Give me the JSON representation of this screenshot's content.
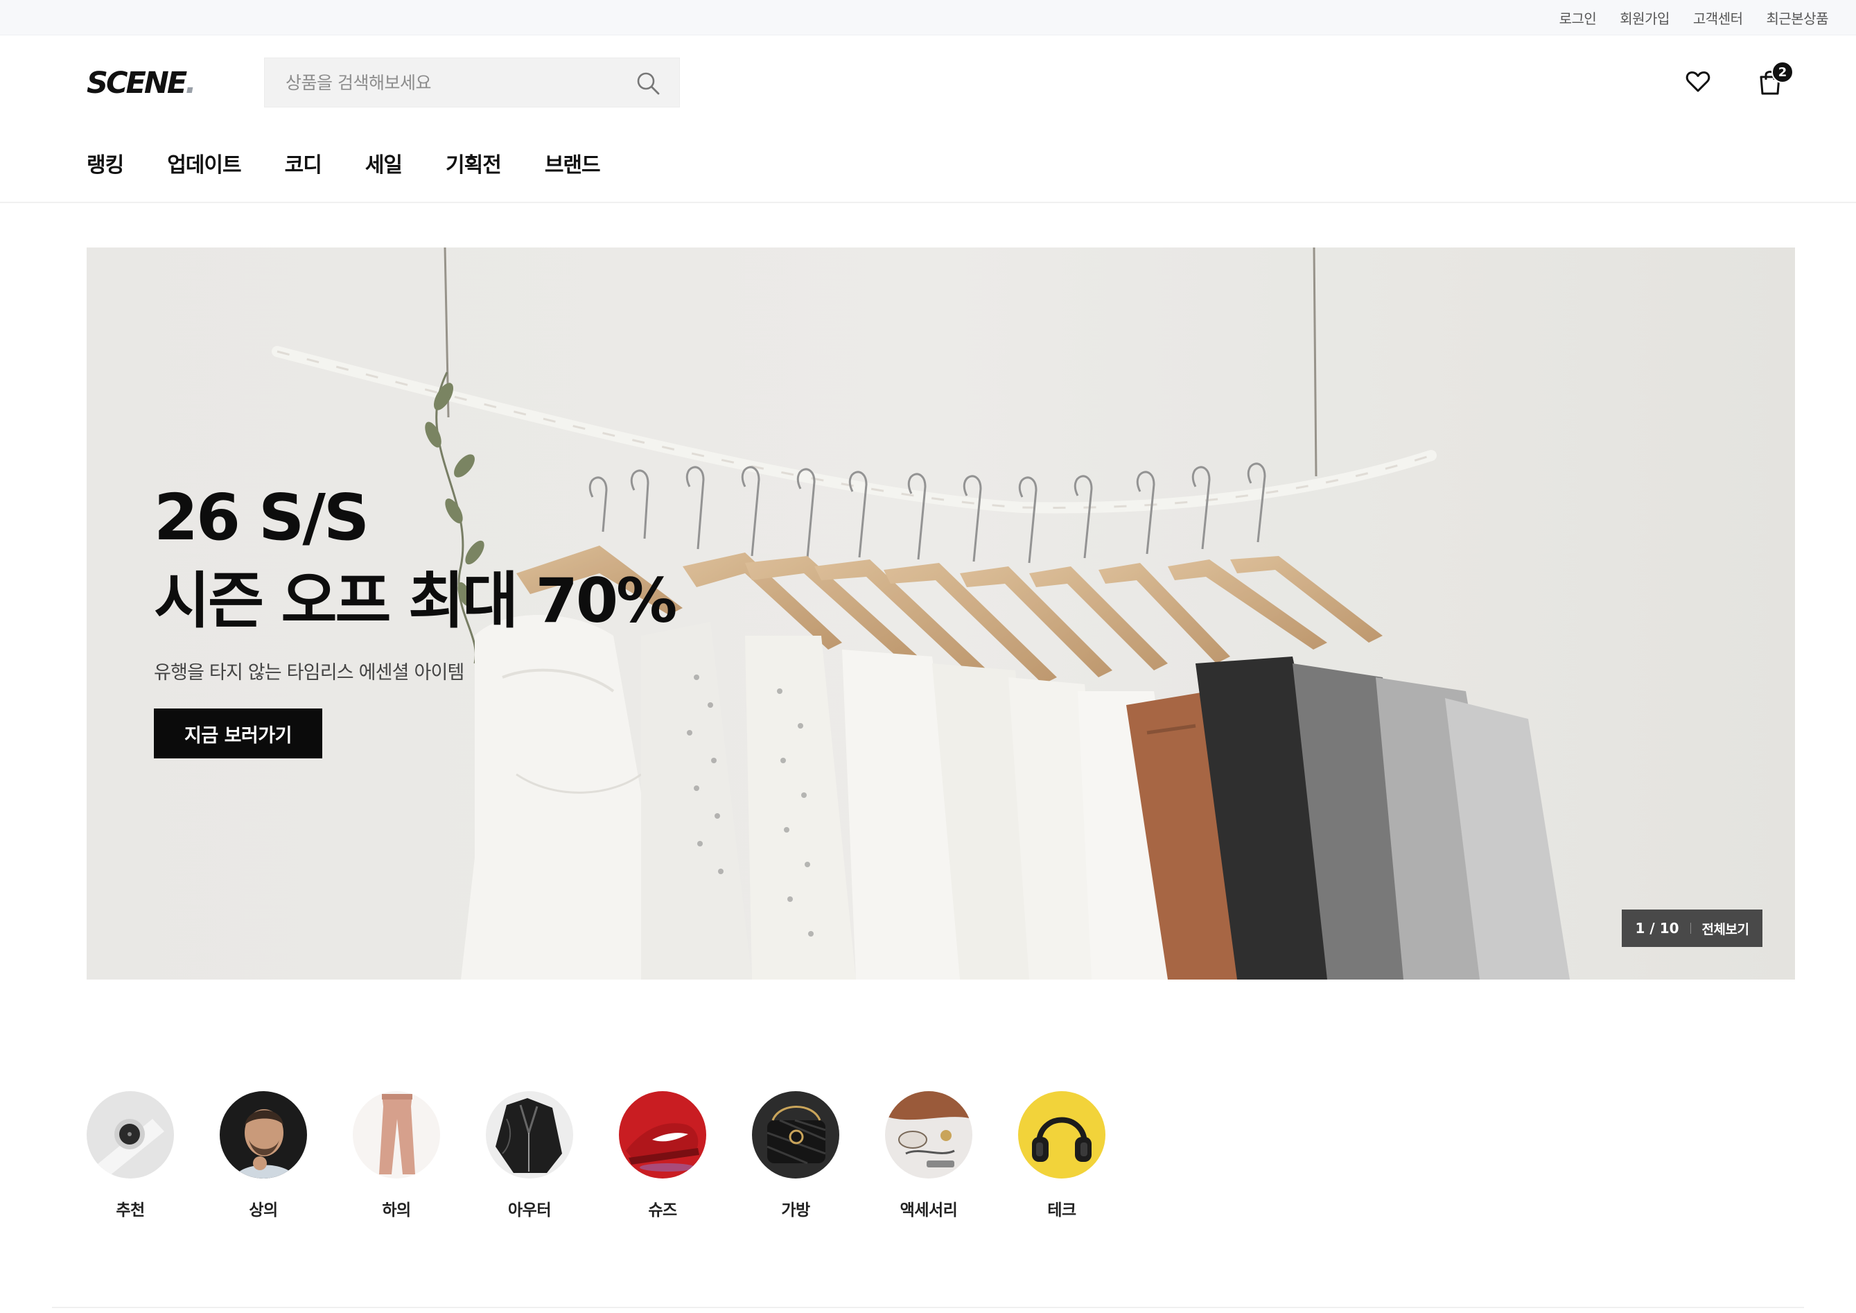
{
  "util_bar": {
    "links": [
      "로그인",
      "회원가입",
      "고객센터",
      "최근본상품"
    ]
  },
  "header": {
    "logo_text": "SCENE",
    "logo_dot": ".",
    "search_placeholder": "상품을 검색해보세요",
    "cart_count": "2",
    "nav": [
      "랭킹",
      "업데이트",
      "코디",
      "세일",
      "기획전",
      "브랜드"
    ]
  },
  "hero": {
    "title_line1": "26 S/S",
    "title_line2": "시즌 오프 최대 70%",
    "subtitle": "유행을 타지 않는 타임리스 에센셜 아이템",
    "cta_label": "지금 보러가기",
    "pager_count": "1 / 10",
    "pager_all_label": "전체보기"
  },
  "categories": [
    {
      "label": "추천",
      "icon": "smartwatch"
    },
    {
      "label": "상의",
      "icon": "man-portrait"
    },
    {
      "label": "하의",
      "icon": "pants"
    },
    {
      "label": "아우터",
      "icon": "leather-jacket"
    },
    {
      "label": "슈즈",
      "icon": "red-sneaker"
    },
    {
      "label": "가방",
      "icon": "black-bag"
    },
    {
      "label": "액세서리",
      "icon": "accessories"
    },
    {
      "label": "테크",
      "icon": "headphones"
    }
  ],
  "colors": {
    "accent": "#111111",
    "util_bg": "#f7f8fa",
    "search_bg": "#f2f2f2",
    "hero_bg": "#ebeae6"
  }
}
